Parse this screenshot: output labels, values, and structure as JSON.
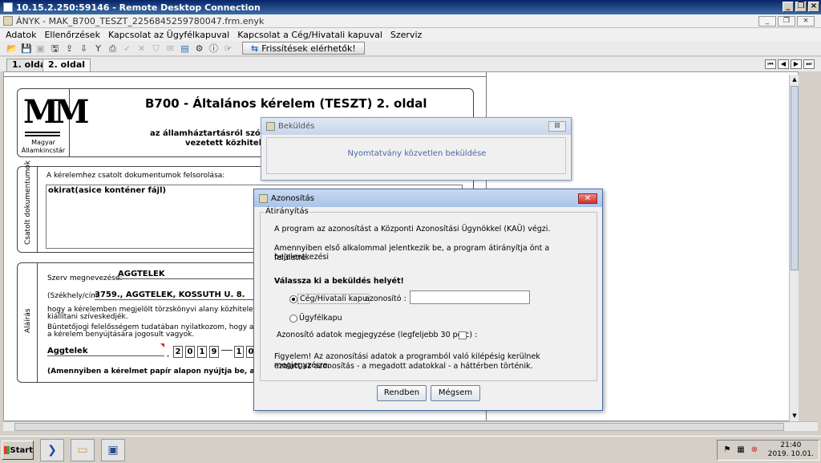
{
  "rdp": {
    "title": "10.15.2.250:59146 - Remote Desktop Connection"
  },
  "app": {
    "title": "ÁNYK - MAK_B700_TESZT_2256845259780047.frm.enyk"
  },
  "menu": [
    "Adatok",
    "Ellenőrzések",
    "Kapcsolat az Ügyfélkapuval",
    "Kapcsolat a Cég/Hivatali kapuval",
    "Szerviz"
  ],
  "toolbar": {
    "refresh_label": "Frissítések elérhetők!"
  },
  "tabs": [
    {
      "label": "1. oldal"
    },
    {
      "label": "2. oldal"
    }
  ],
  "document": {
    "title": "B700 - Általános kérelem (TESZT) 2. oldal",
    "subtitle1": "az államháztartásról szóló 20",
    "subtitle2": "vezetett közhiteles tö",
    "logo_line1": "Magyar",
    "logo_line2": "Államkincstár",
    "side_docs": "Csatolt dokumentumok",
    "docs_label": "A kérelemhez csatolt dokumentumok felsorolása:",
    "docs_value": "okirat(asice konténer fájl)",
    "side_sign": "Aláírás",
    "org_label": "Szerv megnevezése:",
    "org_value": "AGGTELEK",
    "addr_label": "(Székhely/cím:",
    "addr_value": "3759., AGGTELEK, KOSSUTH U. 8.",
    "text1": "hogy a kérelemben megjelölt törzskönyvi alany közhiteles törzskönyvi",
    "text2": "kiállítani szíveskedjék.",
    "text3": "Büntetőjogi felelősségem tudatában nyilatkozom, hogy az általam",
    "text4": "a kérelem benyújtására jogosult vagyok.",
    "place_value": "Aggtelek",
    "date_digits": [
      "2",
      "0",
      "1",
      "9",
      "1",
      "0"
    ],
    "footnote": "(Amennyiben a kérelmet papír alapon nyújtja be, aláírással és bély"
  },
  "dialog_bg": {
    "title": "Beküldés",
    "message": "Nyomtatvány közvetlen beküldése"
  },
  "dialog": {
    "title": "Azonosítás",
    "legend": "Átirányítás",
    "line1": "A program az azonosítást a Központi Azonosítási Ügynökkel (KAÜ) végzi.",
    "line2": "Amennyiben első alkalommal jelentkezik be, a program átirányítja önt a bejelentkezési",
    "line3": "felületre.",
    "choose": "Válassza ki a beküldés helyét!",
    "radio1": "Cég/Hivatali kapu",
    "id_label": "azonosító :",
    "id_value": "",
    "radio2": "Ügyfélkapu",
    "remember": "Azonosító adatok megjegyzése (legfeljebb 30 perc) :",
    "warn1": "Figyelem! Az azonosítási adatok a programból való kilépésig kerülnek megjegyzésre,",
    "warn2": "ezalatt az azonosítás - a megadott adatokkal - a háttérben történik.",
    "ok": "Rendben",
    "cancel": "Mégsem"
  },
  "taskbar": {
    "start": "Start",
    "time": "21:40",
    "date": "2019. 10.01."
  }
}
